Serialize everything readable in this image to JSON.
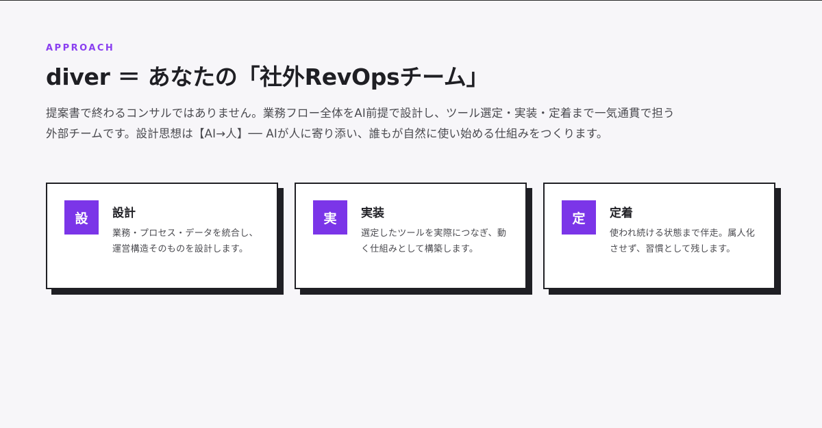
{
  "section": {
    "eyebrow": "APPROACH",
    "title": "diver ＝ あなたの「社外RevOpsチーム」",
    "lead": "提案書で終わるコンサルではありません。業務フロー全体をAI前提で設計し、ツール選定・実装・定着まで一気通貫で担う外部チームです。設計思想は【AI→人】── AIが人に寄り添い、誰もが自然に使い始める仕組みをつくります。"
  },
  "cards": [
    {
      "badge": "設",
      "title": "設計",
      "desc": "業務・プロセス・データを統合し、運営構造そのものを設計します。"
    },
    {
      "badge": "実",
      "title": "実装",
      "desc": "選定したツールを実際につなぎ、動く仕組みとして構築します。"
    },
    {
      "badge": "定",
      "title": "定着",
      "desc": "使われ続ける状態まで伴走。属人化させず、習慣として残します。"
    }
  ],
  "colors": {
    "accent": "#7b35e8",
    "eyebrow": "#8a3ff0",
    "background": "#f7f6f9",
    "ink": "#1f1f24"
  }
}
